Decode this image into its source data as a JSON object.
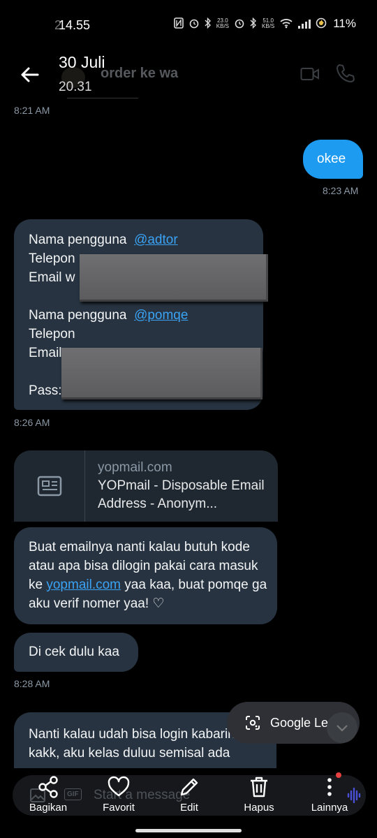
{
  "status_bar": {
    "time": "14.55",
    "ghost_time": "2",
    "upload_speed": "23.0",
    "upload_unit": "KB/S",
    "download_speed": "51.0",
    "download_unit": "KB/S",
    "battery": "11%"
  },
  "header": {
    "date": "30 Juli",
    "time": "20.31",
    "contact_name": "order ke wa"
  },
  "messages": [
    {
      "timestamp": "8:21 AM"
    },
    {
      "direction": "outgoing",
      "text": "okee",
      "timestamp": "8:23 AM"
    },
    {
      "direction": "incoming",
      "timestamp": "8:26 AM",
      "lines": {
        "label_user1": "Nama pengguna",
        "handle1": "@adtor",
        "phone1": "Telepon",
        "email1": "Email  w",
        "label_user2": "Nama pengguna",
        "handle2": "@pomqe",
        "phone2": "Telepon",
        "email2": "Email",
        "pass": "Pass:"
      }
    },
    {
      "direction": "incoming",
      "card": {
        "domain": "yopmail.com",
        "title": "YOPmail - Disposable Email Address - Anonym..."
      },
      "text_before": "Buat emailnya nanti kalau butuh kode atau apa bisa dilogin pakai cara masuk ke ",
      "link": "yopmail.com",
      "text_after": " yaa kaa, buat pomqe ga aku verif nomer yaa! ♡"
    },
    {
      "direction": "incoming",
      "text": "Di cek dulu kaa",
      "timestamp": "8:28 AM"
    },
    {
      "direction": "incoming",
      "text": "Nanti kalau udah bisa login kabarin ya kakk, aku kelas duluu semisal ada"
    }
  ],
  "google_lens": {
    "label": "Google Lens"
  },
  "composer": {
    "placeholder": "Start a message",
    "gif_label": "GIF"
  },
  "toolbar": {
    "share": "Bagikan",
    "favorite": "Favorit",
    "edit": "Edit",
    "delete": "Hapus",
    "more": "Lainnya"
  },
  "colors": {
    "background": "#000000",
    "incoming_bubble": "#273340",
    "outgoing_bubble": "#1d9bf0",
    "link": "#3aa3f5"
  }
}
